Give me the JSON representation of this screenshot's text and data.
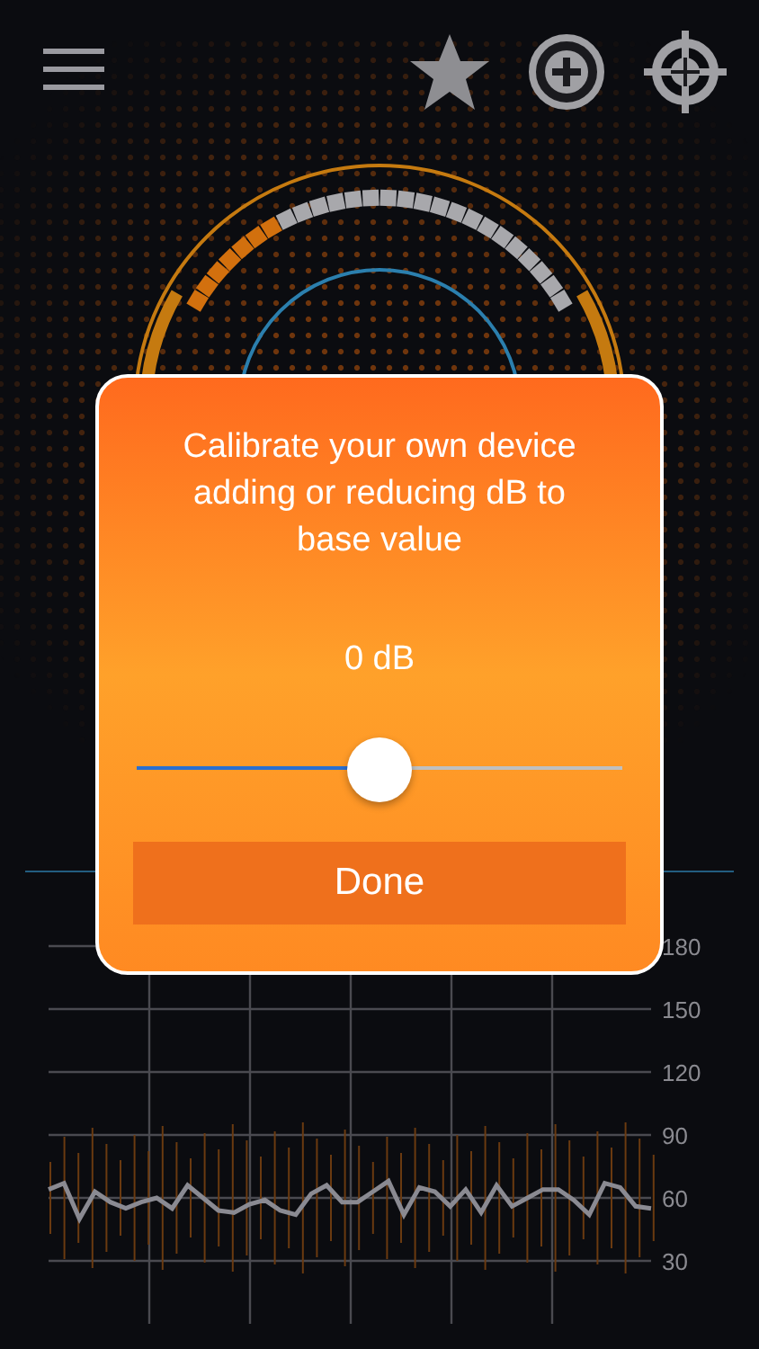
{
  "gauge": {
    "level": 0.27
  },
  "dialog": {
    "message": "Calibrate your own device adding or reducing dB to base value",
    "value": "0 dB",
    "slider": {
      "level": 0.5
    },
    "button": "Done"
  },
  "chart": {
    "chart_data": {
      "type": "line",
      "grid": true,
      "yticks": [
        30,
        60,
        90,
        120,
        150,
        180
      ],
      "ylim": [
        30,
        180
      ],
      "series": [
        {
          "color": "#8a8a92",
          "values": [
            64,
            67,
            50,
            63,
            58,
            55,
            58,
            60,
            55,
            66,
            60,
            54,
            53,
            57,
            59,
            54,
            52,
            62,
            66,
            58,
            58,
            63,
            68,
            52,
            65,
            63,
            56,
            64,
            53,
            66,
            56,
            60,
            64,
            64,
            59,
            52,
            67,
            65,
            56,
            55
          ]
        }
      ]
    }
  }
}
